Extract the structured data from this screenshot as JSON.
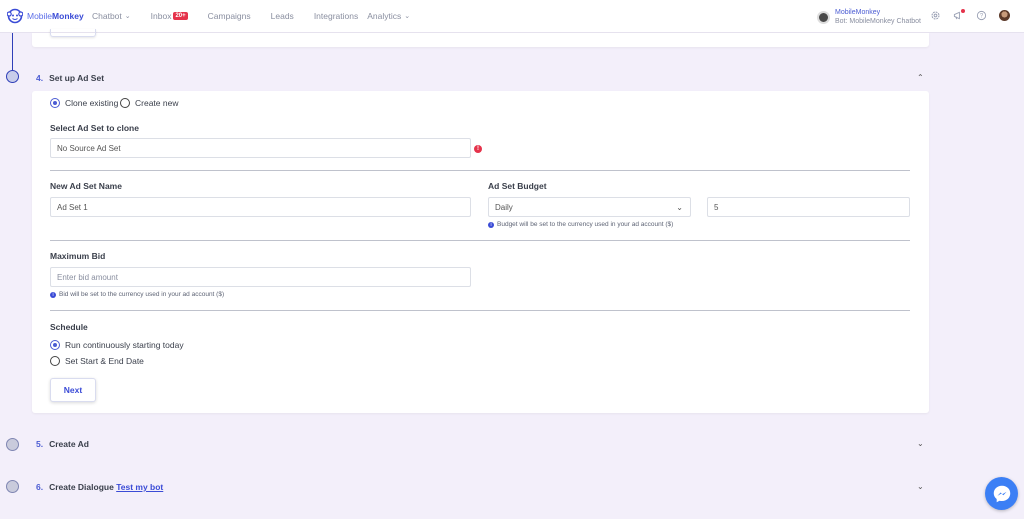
{
  "app": {
    "logo_text_a": "Mobile",
    "logo_text_b": "Monkey"
  },
  "nav": {
    "chatbot": "Chatbot",
    "inbox": "Inbox",
    "inbox_badge": "20+",
    "campaigns": "Campaigns",
    "leads": "Leads",
    "integrations": "Integrations",
    "analytics": "Analytics"
  },
  "account": {
    "name": "MobileMonkey",
    "bot": "Bot: MobileMonkey Chatbot"
  },
  "steps": {
    "s4": {
      "num": "4.",
      "title": "Set up Ad Set"
    },
    "s5": {
      "num": "5.",
      "title": "Create Ad"
    },
    "s6": {
      "num": "6.",
      "title": "Create Dialogue",
      "link": "Test my bot"
    }
  },
  "form": {
    "clone_existing": "Clone existing",
    "create_new": "Create new",
    "select_label": "Select Ad Set to clone",
    "select_value": "No Source Ad Set",
    "name_label": "New Ad Set Name",
    "name_value": "Ad Set 1",
    "budget_label": "Ad Set Budget",
    "budget_type": "Daily",
    "budget_value": "5",
    "budget_hint": "Budget will be set to the currency used in your ad account ($)",
    "bid_label": "Maximum Bid",
    "bid_placeholder": "Enter bid amount",
    "bid_hint": "Bid will be set to the currency used in your ad account ($)",
    "schedule_label": "Schedule",
    "schedule_continuous": "Run continuously starting today",
    "schedule_dates": "Set Start & End Date",
    "next_label": "Next"
  },
  "colors": {
    "accent": "#3a4bd6",
    "error": "#e5334b",
    "messenger": "#3b7ff5"
  }
}
